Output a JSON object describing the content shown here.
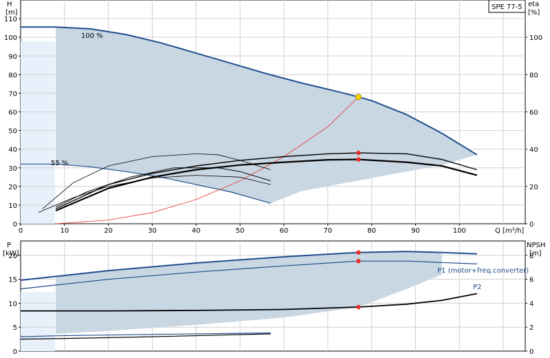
{
  "pump_label": "SPE 77-5",
  "colors": {
    "envelope_fill": "#c9d7e3",
    "light_fill": "#e8f1fb",
    "curve_blue": "#1f4e8c",
    "system_red": "#e8302a",
    "op_point": "#f5d400"
  },
  "top_chart": {
    "y_left_title": [
      "H",
      "[m]"
    ],
    "y_right_title": [
      "eta",
      "[%]"
    ],
    "x_label": "Q [m³/h]",
    "y_ticks": [
      0,
      10,
      20,
      30,
      40,
      50,
      60,
      70,
      80,
      90,
      100,
      110
    ],
    "eta_ticks": [
      0,
      20,
      40,
      60,
      80,
      100
    ],
    "x_ticks": [
      0,
      10,
      20,
      30,
      40,
      50,
      60,
      70,
      80,
      90,
      100
    ],
    "label_100": "100 %",
    "label_55": "55 %"
  },
  "bottom_chart": {
    "y_left_title": [
      "P",
      "[kW]"
    ],
    "y_right_title": [
      "NPSH",
      "[m]"
    ],
    "y_ticks": [
      0,
      5,
      10,
      15,
      20
    ],
    "npsh_ticks": [
      0,
      2,
      4,
      6,
      8
    ],
    "p1_label": "P1 (motor+freq.converter)",
    "p2_label": "P2"
  },
  "chart_data": [
    {
      "type": "line",
      "title": "",
      "xlabel": "Q [m³/h]",
      "ylabel": "H [m]",
      "xlim": [
        0,
        115
      ],
      "ylim": [
        0,
        120
      ],
      "y2lim": [
        0,
        120
      ],
      "series": [
        {
          "name": "100 %",
          "x": [
            0,
            8,
            16,
            24,
            32,
            40,
            48,
            56,
            64,
            72,
            77,
            80,
            88,
            96,
            104
          ],
          "y": [
            105.5,
            105.5,
            104.5,
            101.5,
            97,
            91.5,
            86,
            80.5,
            75.5,
            71,
            68,
            66,
            58.5,
            48.5,
            37
          ]
        },
        {
          "name": "55 %",
          "x": [
            0,
            8,
            16,
            24,
            32,
            40,
            48,
            57
          ],
          "y": [
            32,
            32,
            30.5,
            28,
            25,
            21,
            17,
            11
          ]
        },
        {
          "x": [
            8,
            20,
            30,
            40,
            50,
            60,
            70,
            77
          ],
          "y": [
            0,
            2,
            6,
            13,
            23,
            36,
            52,
            68
          ]
        },
        {
          "x": [
            8,
            20,
            30,
            40,
            50,
            60,
            70,
            77,
            88,
            96,
            104
          ],
          "y": [
            8,
            21,
            27,
            31,
            34,
            36,
            37.5,
            38,
            37.5,
            34.5,
            29
          ]
        },
        {
          "x": [
            8,
            20,
            30,
            40,
            50,
            60,
            70,
            77,
            88,
            96,
            104
          ],
          "y": [
            7,
            19,
            25,
            29,
            31.5,
            33,
            34.3,
            34.5,
            33,
            31,
            26
          ]
        },
        {
          "x": [
            5,
            12,
            20,
            30,
            40,
            45,
            50,
            57
          ],
          "y": [
            8,
            22,
            31,
            36,
            37.5,
            37,
            34,
            29
          ]
        },
        {
          "x": [
            8,
            15,
            25,
            35,
            45,
            50,
            57
          ],
          "y": [
            9,
            17,
            25,
            30,
            30,
            28,
            23
          ]
        },
        {
          "x": [
            4,
            12,
            20,
            30,
            40,
            50,
            57
          ],
          "y": [
            6,
            14,
            20,
            24.5,
            26,
            25,
            21
          ]
        }
      ],
      "envelope_polygon": [
        [
          8,
          105.5
        ],
        [
          16,
          104.5
        ],
        [
          24,
          101.5
        ],
        [
          32,
          97
        ],
        [
          40,
          91.5
        ],
        [
          48,
          86
        ],
        [
          56,
          80.5
        ],
        [
          64,
          75.5
        ],
        [
          72,
          71
        ],
        [
          77,
          68
        ],
        [
          80,
          66
        ],
        [
          88,
          58.5
        ],
        [
          96,
          48.5
        ],
        [
          104,
          37
        ],
        [
          96,
          31.5
        ],
        [
          88,
          28
        ],
        [
          80,
          24.5
        ],
        [
          72,
          21
        ],
        [
          64,
          17.5
        ],
        [
          57,
          11
        ],
        [
          48,
          17
        ],
        [
          40,
          21
        ],
        [
          32,
          25
        ],
        [
          24,
          28
        ],
        [
          16,
          30.5
        ],
        [
          8,
          32
        ]
      ],
      "operating_points": [
        {
          "x": 77,
          "y": 68
        },
        {
          "x": 77,
          "y": 38
        },
        {
          "x": 77,
          "y": 34.5
        }
      ]
    },
    {
      "type": "line",
      "title": "",
      "xlabel": "",
      "ylabel": "P [kW]",
      "xlim": [
        0,
        115
      ],
      "ylim": [
        0,
        23
      ],
      "y2lim": [
        0,
        9.2
      ],
      "series": [
        {
          "name": "P1 (motor+freq.converter)",
          "x": [
            0,
            8,
            20,
            40,
            60,
            77,
            88,
            96,
            104
          ],
          "y": [
            14.8,
            15.6,
            16.8,
            18.4,
            19.7,
            20.6,
            20.8,
            20.6,
            20.3
          ]
        },
        {
          "name": "P2",
          "x": [
            0,
            8,
            20,
            40,
            60,
            77,
            88,
            96,
            104
          ],
          "y": [
            13,
            13.8,
            15,
            16.5,
            17.8,
            18.8,
            18.8,
            18.5,
            18.2
          ]
        },
        {
          "x": [
            0,
            8,
            20,
            40,
            60,
            77,
            88,
            96,
            104
          ],
          "y": [
            8.4,
            8.4,
            8.4,
            8.5,
            8.7,
            9.2,
            9.8,
            10.6,
            12
          ]
        },
        {
          "x": [
            0,
            8,
            30,
            57
          ],
          "y": [
            3,
            3.2,
            3.5,
            3.8
          ]
        },
        {
          "x": [
            0,
            8,
            30,
            57
          ],
          "y": [
            2.5,
            2.6,
            3.0,
            3.6
          ]
        }
      ],
      "envelope_polygon": [
        [
          8,
          15.6
        ],
        [
          20,
          16.8
        ],
        [
          40,
          18.4
        ],
        [
          60,
          19.7
        ],
        [
          77,
          20.6
        ],
        [
          88,
          20.8
        ],
        [
          96,
          20.6
        ],
        [
          96,
          16
        ],
        [
          88,
          13
        ],
        [
          77,
          9.2
        ],
        [
          60,
          7
        ],
        [
          40,
          5.5
        ],
        [
          20,
          4.2
        ],
        [
          8,
          3.6
        ]
      ],
      "operating_points": [
        {
          "x": 77,
          "y": 20.6
        },
        {
          "x": 77,
          "y": 18.8
        },
        {
          "x": 77,
          "y": 9.2
        }
      ]
    }
  ]
}
